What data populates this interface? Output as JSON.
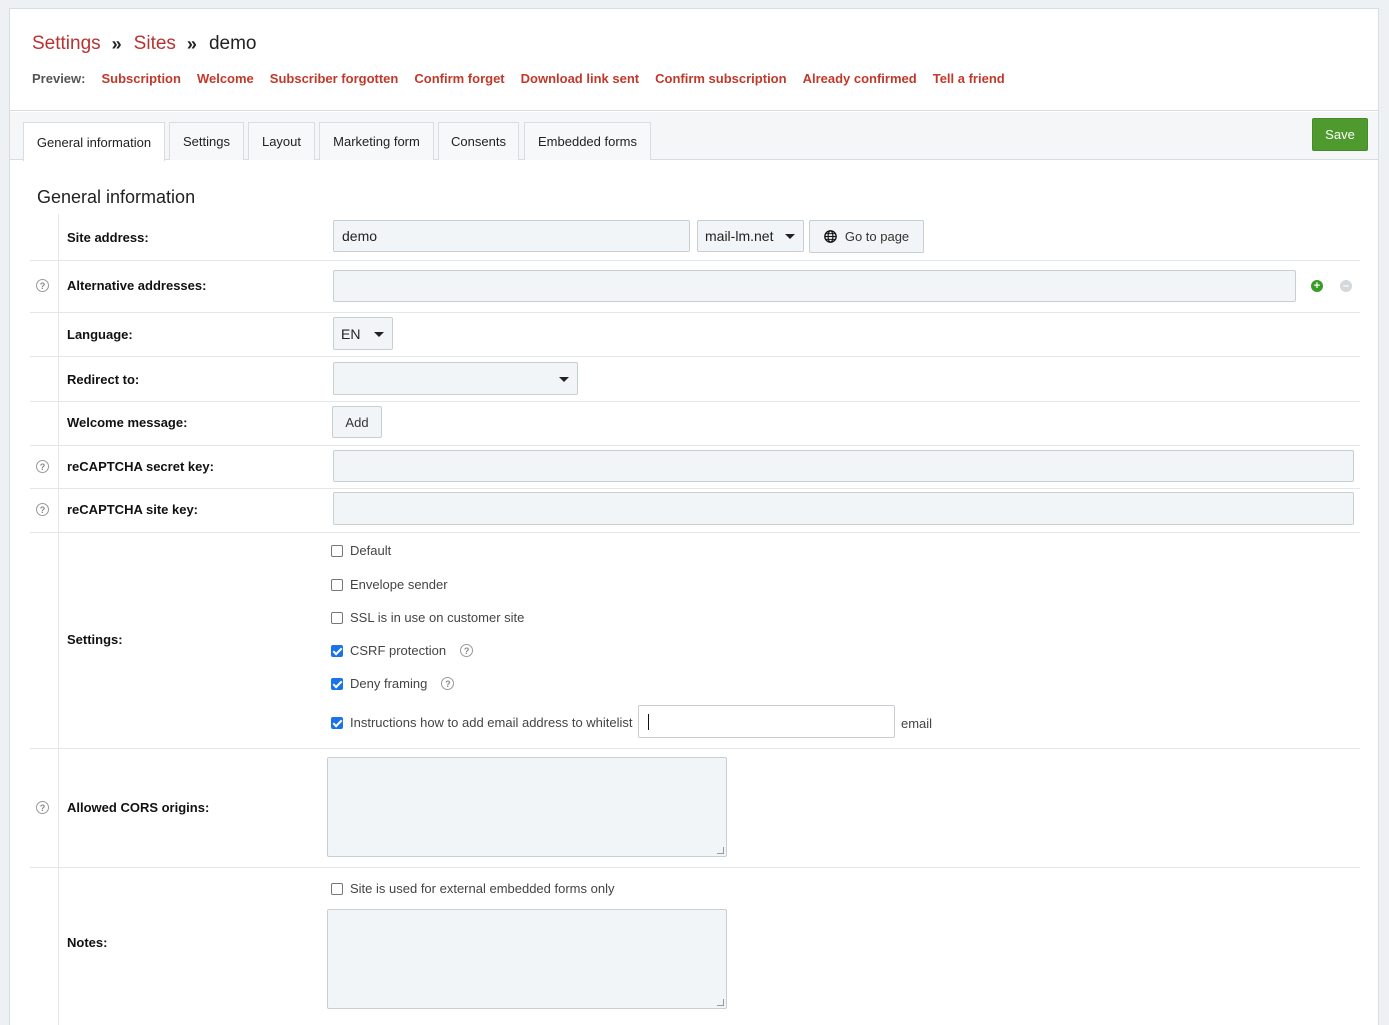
{
  "breadcrumb": {
    "settings": "Settings",
    "sites": "Sites",
    "current": "demo",
    "separator": "»"
  },
  "preview": {
    "label": "Preview:",
    "links": [
      "Subscription",
      "Welcome",
      "Subscriber forgotten",
      "Confirm forget",
      "Download link sent",
      "Confirm subscription",
      "Already confirmed",
      "Tell a friend"
    ]
  },
  "tabs": [
    "General information",
    "Settings",
    "Layout",
    "Marketing form",
    "Consents",
    "Embedded forms"
  ],
  "save_label": "Save",
  "section_title": "General information",
  "fields": {
    "site_address": {
      "label": "Site address:",
      "value": "demo",
      "domain": "mail-lm.net",
      "go_to_page": "Go to page"
    },
    "alternative_addresses": {
      "label": "Alternative addresses:",
      "value": ""
    },
    "language": {
      "label": "Language:",
      "value": "EN"
    },
    "redirect_to": {
      "label": "Redirect to:",
      "value": ""
    },
    "welcome_message": {
      "label": "Welcome message:",
      "add": "Add"
    },
    "recaptcha_secret": {
      "label": "reCAPTCHA secret key:",
      "value": ""
    },
    "recaptcha_site": {
      "label": "reCAPTCHA site key:",
      "value": ""
    },
    "settings": {
      "label": "Settings:",
      "options": [
        {
          "text": "Default",
          "checked": false
        },
        {
          "text": "Envelope sender",
          "checked": false
        },
        {
          "text": "SSL is in use on customer site",
          "checked": false
        },
        {
          "text": "CSRF protection",
          "checked": true
        },
        {
          "text": "Deny framing",
          "checked": true
        },
        {
          "text": "Instructions how to add email address to whitelist",
          "checked": true
        }
      ],
      "whitelist_suffix": "email"
    },
    "cors": {
      "label": "Allowed CORS origins:"
    },
    "notes": {
      "label": "Notes:",
      "external_only": "Site is used for external embedded forms only"
    }
  },
  "help_glyph": "?"
}
